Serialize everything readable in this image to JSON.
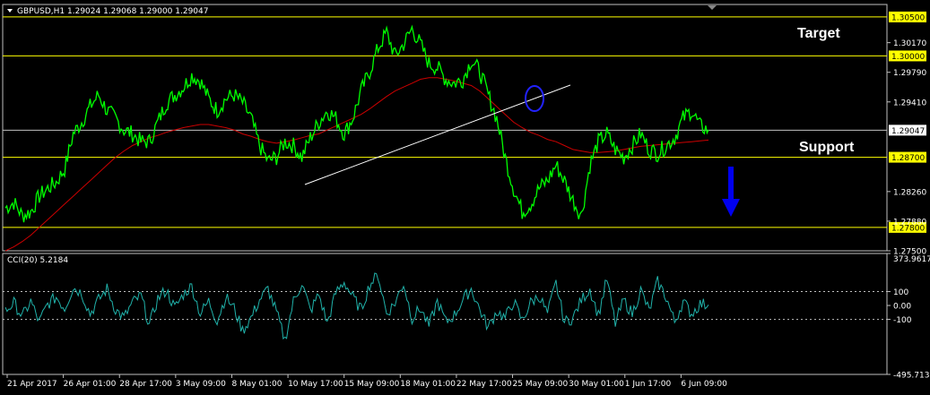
{
  "main_header": "GBPUSD,H1  1.29024 1.29068 1.29000 1.29047",
  "cci_header": "CCI(20) 5.2184",
  "annotations": {
    "target": "Target",
    "support": "Support"
  },
  "colors": {
    "background": "#000000",
    "price": "#00ff00",
    "ma": "#cc0000",
    "level": "#ffff00",
    "trendline": "#ffffff",
    "arrow": "#0000ee",
    "cci": "#20b2aa",
    "grid": "#c0c0c0"
  },
  "chart_data": [
    {
      "type": "line",
      "symbol": "GBPUSD",
      "timeframe": "H1",
      "ylim": [
        1.275,
        1.3066
      ],
      "price_axis_ticks": [
        "1.30500",
        "1.30170",
        "1.29790",
        "1.29410",
        "1.29047",
        "1.28700",
        "1.28260",
        "1.27880",
        "1.27500"
      ],
      "highlighted_levels": [
        {
          "value": "1.30500"
        },
        {
          "value": "1.30000"
        },
        {
          "value": "1.29047"
        },
        {
          "value": "1.28700"
        },
        {
          "value": "1.27800"
        }
      ],
      "time_axis_ticks": [
        "21 Apr 2017",
        "26 Apr 01:00",
        "28 Apr 17:00",
        "3 May 09:00",
        "8 May 01:00",
        "10 May 17:00",
        "15 May 09:00",
        "18 May 01:00",
        "22 May 17:00",
        "25 May 09:00",
        "30 May 01:00",
        "1 Jun 17:00",
        "6 Jun 09:00"
      ],
      "series": [
        {
          "close": [
            1.2805,
            1.2812,
            1.2795,
            1.28,
            1.282,
            1.283,
            1.2838,
            1.2855,
            1.29,
            1.2915,
            1.2935,
            1.295,
            1.293,
            1.292,
            1.2905,
            1.29,
            1.289,
            1.289,
            1.2915,
            1.294,
            1.295,
            1.296,
            1.2975,
            1.2968,
            1.2945,
            1.293,
            1.2945,
            1.295,
            1.294,
            1.292,
            1.2885,
            1.2865,
            1.287,
            1.289,
            1.2885,
            1.287,
            1.2895,
            1.2915,
            1.293,
            1.292,
            1.29,
            1.292,
            1.2955,
            1.298,
            1.301,
            1.303,
            1.3,
            1.3015,
            1.3035,
            1.3015,
            1.299,
            1.2985,
            1.297,
            1.2965,
            1.297,
            1.2995,
            1.298,
            1.295,
            1.292,
            1.287,
            1.283,
            1.28,
            1.281,
            1.283,
            1.284,
            1.286,
            1.284,
            1.2815,
            1.2795,
            1.286,
            1.289,
            1.29,
            1.288,
            1.287,
            1.2885,
            1.29,
            1.288,
            1.2875,
            1.2885,
            1.2895,
            1.292,
            1.293,
            1.291,
            1.2905
          ],
          "ma": [
            1.275,
            1.2755,
            1.2762,
            1.277,
            1.278,
            1.279,
            1.28,
            1.281,
            1.282,
            1.283,
            1.284,
            1.285,
            1.286,
            1.287,
            1.2878,
            1.2885,
            1.289,
            1.2895,
            1.2898,
            1.2902,
            1.2905,
            1.2908,
            1.291,
            1.2912,
            1.2912,
            1.291,
            1.2908,
            1.2905,
            1.29,
            1.2897,
            1.2893,
            1.289,
            1.2888,
            1.289,
            1.2892,
            1.2895,
            1.2898,
            1.29,
            1.2905,
            1.291,
            1.2915,
            1.292,
            1.2925,
            1.2932,
            1.294,
            1.2948,
            1.2955,
            1.296,
            1.2965,
            1.297,
            1.2972,
            1.2972,
            1.297,
            1.2968,
            1.2965,
            1.2962,
            1.2955,
            1.2945,
            1.2935,
            1.2925,
            1.2915,
            1.2908,
            1.2902,
            1.2898,
            1.2893,
            1.289,
            1.2885,
            1.288,
            1.2878,
            1.2876,
            1.2876,
            1.2877,
            1.2878,
            1.288,
            1.2882,
            1.2884,
            1.2885,
            1.2886,
            1.2887,
            1.2888,
            1.2889,
            1.289,
            1.2891,
            1.2892
          ]
        }
      ]
    },
    {
      "type": "line",
      "indicator": "CCI(20)",
      "ylim": [
        -495.7138,
        373.9617
      ],
      "axis_ticks": [
        "373.9617",
        "100",
        "0.00",
        "-100",
        "-495.7138"
      ],
      "levels": [
        100,
        -100
      ],
      "series": [
        {
          "values": [
            -40,
            20,
            -80,
            30,
            -120,
            10,
            60,
            -20,
            130,
            90,
            -60,
            40,
            120,
            -30,
            -90,
            20,
            70,
            -140,
            50,
            110,
            -20,
            80,
            140,
            -60,
            30,
            -110,
            60,
            -20,
            -180,
            -90,
            40,
            120,
            -50,
            -250,
            30,
            160,
            -40,
            80,
            -130,
            90,
            170,
            60,
            -30,
            150,
            220,
            -60,
            20,
            160,
            -90,
            -20,
            -150,
            30,
            -120,
            -70,
            40,
            120,
            -30,
            -160,
            -40,
            -90,
            30,
            -110,
            20,
            70,
            -60,
            160,
            -120,
            -90,
            40,
            120,
            -70,
            190,
            -130,
            40,
            -60,
            110,
            -40,
            170,
            60,
            -120,
            30,
            -60,
            10,
            5
          ]
        }
      ]
    }
  ]
}
